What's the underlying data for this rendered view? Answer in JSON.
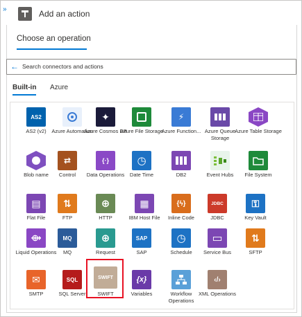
{
  "header": {
    "expand_glyph": "»",
    "title": "Add an action"
  },
  "operation_tab": "Choose an operation",
  "search": {
    "placeholder": "Search connectors and actions",
    "icon": "back-arrow-icon"
  },
  "tabs": [
    {
      "label": "Built-in",
      "selected": true
    },
    {
      "label": "Azure",
      "selected": false
    }
  ],
  "connectors": [
    {
      "label": "AS2 (v2)",
      "color": "#0062ad",
      "icon": "as2-icon"
    },
    {
      "label": "Azure Automation",
      "color": "#e8f0fb",
      "icon": "azure-automation-icon"
    },
    {
      "label": "Azure Cosmos DB",
      "color": "#1b1b3a",
      "icon": "cosmos-db-icon"
    },
    {
      "label": "Azure File Storage",
      "color": "#1e8a3a",
      "icon": "file-storage-icon"
    },
    {
      "label": "Azure Function...",
      "color": "#3a7bd5",
      "icon": "azure-functions-icon"
    },
    {
      "label": "Azure Queue Storage",
      "color": "#6a49a8",
      "icon": "queue-storage-icon"
    },
    {
      "label": "Azure Table Storage",
      "color": "#8a47c4",
      "icon": "table-storage-icon"
    },
    {
      "label": "Blob name",
      "color": "#7f50c0",
      "icon": "blob-icon"
    },
    {
      "label": "Control",
      "color": "#a4521f",
      "icon": "control-icon"
    },
    {
      "label": "Data Operations",
      "color": "#8a49c6",
      "icon": "data-operations-icon"
    },
    {
      "label": "Date Time",
      "color": "#1d72c4",
      "icon": "clock-icon"
    },
    {
      "label": "DB2",
      "color": "#7c47b3",
      "icon": "db2-icon"
    },
    {
      "label": "Event Hubs",
      "color": "#e8f4ea",
      "icon": "event-hubs-icon"
    },
    {
      "label": "File System",
      "color": "#1e8a3a",
      "icon": "folder-icon"
    },
    {
      "label": "Flat File",
      "color": "#7c47b3",
      "icon": "flat-file-icon"
    },
    {
      "label": "FTP",
      "color": "#e07a1c",
      "icon": "ftp-icon"
    },
    {
      "label": "HTTP",
      "color": "#6a8a55",
      "icon": "http-globe-icon"
    },
    {
      "label": "IBM Host File",
      "color": "#7c47b3",
      "icon": "ibm-host-file-icon"
    },
    {
      "label": "Inline Code",
      "color": "#d96d1c",
      "icon": "inline-code-icon"
    },
    {
      "label": "JDBC",
      "color": "#cc3a2a",
      "icon": "jdbc-icon"
    },
    {
      "label": "Key Vault",
      "color": "#1d72c4",
      "icon": "key-vault-icon"
    },
    {
      "label": "Liquid Operations",
      "color": "#8a47c4",
      "icon": "liquid-icon"
    },
    {
      "label": "MQ",
      "color": "#2b5b99",
      "icon": "mq-icon"
    },
    {
      "label": "Request",
      "color": "#2a9a90",
      "icon": "request-globe-icon"
    },
    {
      "label": "SAP",
      "color": "#1d72c4",
      "icon": "sap-icon"
    },
    {
      "label": "Schedule",
      "color": "#1d72c4",
      "icon": "schedule-clock-icon"
    },
    {
      "label": "Service Bus",
      "color": "#7c47b3",
      "icon": "service-bus-icon"
    },
    {
      "label": "SFTP",
      "color": "#e07a1c",
      "icon": "sftp-icon"
    },
    {
      "label": "SMTP",
      "color": "#e8642a",
      "icon": "mail-icon"
    },
    {
      "label": "SQL Server",
      "color": "#b51c1c",
      "icon": "sql-server-icon"
    },
    {
      "label": "SWIFT",
      "color": "#c1ac97",
      "icon": "swift-icon"
    },
    {
      "label": "Variables",
      "color": "#6a3aa8",
      "icon": "variables-icon"
    },
    {
      "label": "Workflow Operations",
      "color": "#5aa0d8",
      "icon": "workflow-operations-icon"
    },
    {
      "label": "XML Operations",
      "color": "#a08070",
      "icon": "xml-icon"
    }
  ],
  "glyphs": {
    "as2": "AS2",
    "cosmos": "✦",
    "func": "⚡",
    "control": "⇄",
    "data": "{·}",
    "clock": "◷",
    "db2": "DB2",
    "flat": "▤",
    "ftp": "⇅",
    "http": "⊕",
    "ibm": "▦",
    "code": "{ϟ}",
    "jdbc": "JDBC",
    "key": "⚿",
    "liquid": "⟴",
    "mq": "MQ",
    "sap": "SAP",
    "svcbus": "▭",
    "smtp": "✉",
    "sql": "SQL",
    "swift": "SWIFT",
    "vars": "{x}",
    "xml": "‹/›"
  }
}
